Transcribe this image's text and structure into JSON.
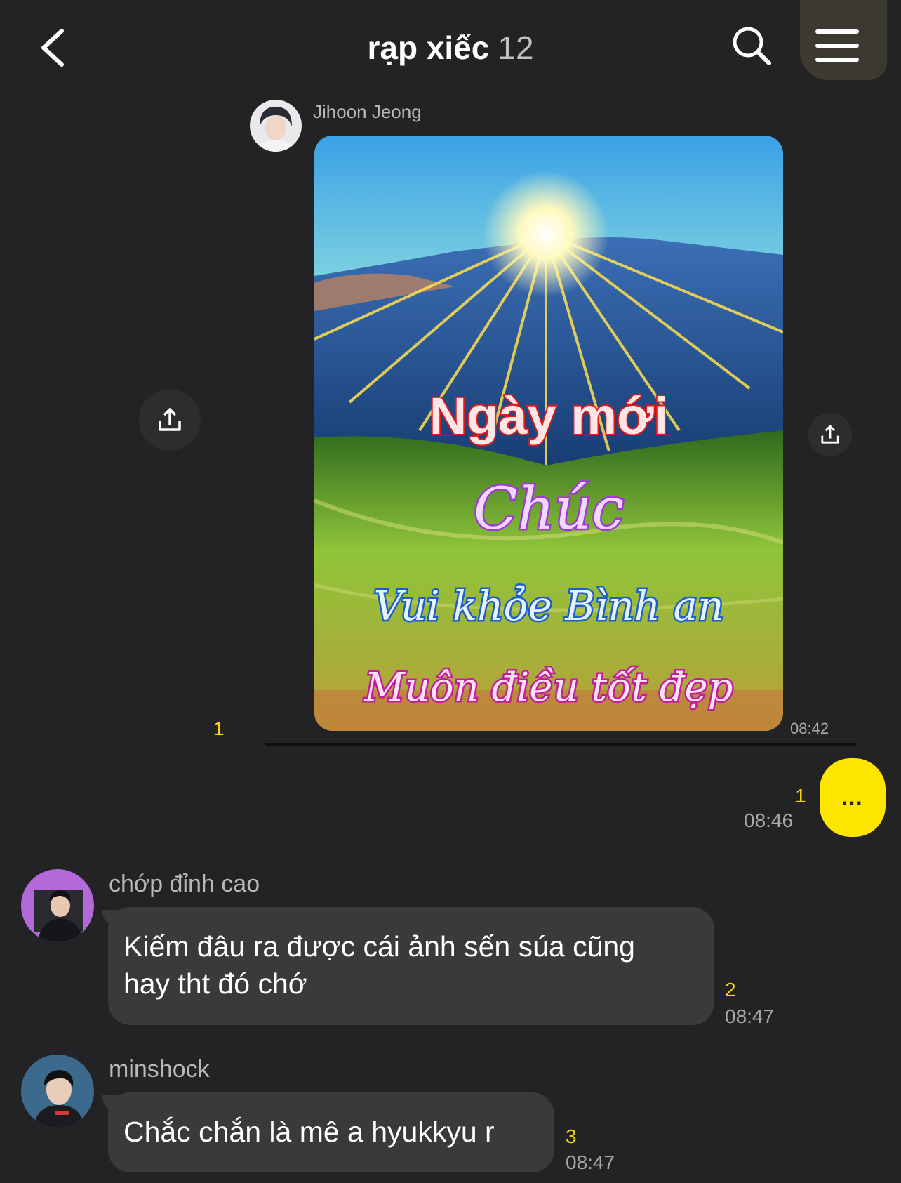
{
  "header": {
    "title": "rạp xiếc",
    "member_count": "12",
    "back_icon": "chevron-left-icon",
    "search_icon": "search-icon",
    "menu_icon": "hamburger-menu-icon"
  },
  "messages": {
    "photo_message": {
      "sender": "Jihoon Jeong",
      "unread": "1",
      "time": "08:42",
      "share_icon": "share-icon",
      "overlay": {
        "line1": "Ngày mới",
        "line2": "Chúc",
        "line3": "Vui khỏe Bình an",
        "line4": "Muôn điều tốt đẹp"
      }
    },
    "my_message": {
      "text": "...",
      "unread": "1",
      "time": "08:46"
    },
    "message_2": {
      "sender": "chớp đỉnh cao",
      "text_line1": "Kiếm đâu ra được cái ảnh sến súa cũng",
      "text_line2": "hay tht đó chớ",
      "unread": "2",
      "time": "08:47"
    },
    "message_3": {
      "sender": "minshock",
      "text": "Chắc chắn là mê a hyukkyu r",
      "unread": "3",
      "time": "08:47"
    }
  },
  "colors": {
    "background": "#232325",
    "bubble": "#3a3a3c",
    "my_bubble": "#fee500",
    "unread": "#f5d90a"
  }
}
